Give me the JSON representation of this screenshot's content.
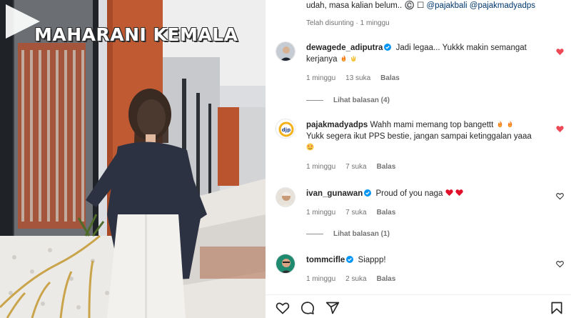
{
  "video": {
    "overlay_title": "MAHARANI KEMALA"
  },
  "caption": {
    "text_before": "udah, masa kalian belum.. ",
    "symbols": "©️ ☐ ",
    "mention_1": "@pajakbali",
    "mention_2": "@pajakmadyadps",
    "meta": "Telah disunting · 1 minggu"
  },
  "comments": [
    {
      "username": "dewagede_adiputra",
      "verified": true,
      "text": "Jadi legaa... Yukkk makin semangat kerjanya",
      "emojis": [
        "fire",
        "clap"
      ],
      "time": "1 minggu",
      "likes": "13 suka",
      "reply_label": "Balas",
      "liked": true,
      "view_replies": "Lihat balasan (4)"
    },
    {
      "username": "pajakmadyadps",
      "verified": false,
      "avatar_text": "djp",
      "text_line1": "Wahh mami memang top bangettt",
      "text_line2": "Yukk segera ikut PPS bestie, jangan sampai ketinggalan yaaa",
      "emojis": [
        "fire",
        "fire",
        "heart-eyes"
      ],
      "time": "1 minggu",
      "likes": "7 suka",
      "reply_label": "Balas",
      "liked": true
    },
    {
      "username": "ivan_gunawan",
      "verified": true,
      "text": "Proud of you naga",
      "emojis": [
        "red-heart",
        "red-heart"
      ],
      "time": "1 minggu",
      "likes": "7 suka",
      "reply_label": "Balas",
      "liked": false,
      "view_replies": "Lihat balasan (1)"
    },
    {
      "username": "tommcifle",
      "verified": true,
      "text": "Siappp!",
      "time": "1 minggu",
      "likes": "2 suka",
      "reply_label": "Balas",
      "liked": false
    }
  ],
  "actions": {
    "icons": [
      "heart-outline-icon",
      "comment-icon",
      "share-icon",
      "bookmark-icon"
    ]
  },
  "colors": {
    "like_red": "#ed4956",
    "verified_blue": "#0095f6",
    "meta_gray": "#737373"
  }
}
